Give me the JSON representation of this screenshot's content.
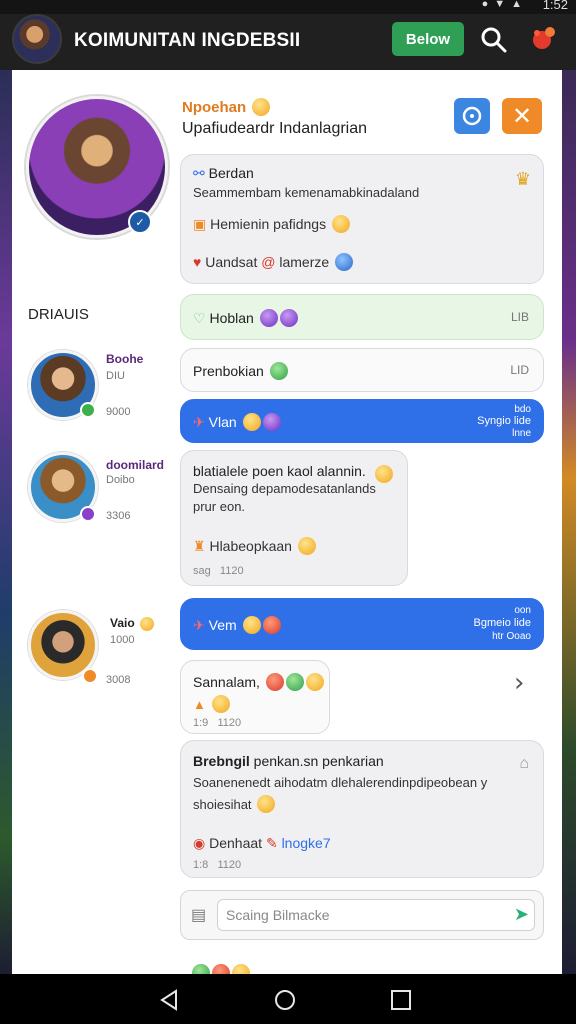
{
  "status": {
    "time": "1:52"
  },
  "header": {
    "title": "KOIMUNITAN INGDEBSII",
    "follow_label": "Below"
  },
  "profile": {
    "name": "Npoehan",
    "subtitle": "Upafiudeardr Indanlagrian"
  },
  "section_label": "DRIAUIS",
  "posts": {
    "p1_title": "Berdan",
    "p1_line": "Seammembam kemenamabkinadaland",
    "p1_item1": "Hemienin pafidngs",
    "p1_item2_a": "Uandsat",
    "p1_item2_b": "lamerze",
    "p2_title": "Hoblan",
    "p2_meta": "LIB",
    "p3_title": "Prenbokian",
    "p3_meta": "LID",
    "p4_title": "Vlan",
    "p4_meta_1": "bdo",
    "p4_meta_2": "Syngio lide",
    "p4_meta_3": "lnne",
    "p5_line1": "blatialele poen kaol alannin.",
    "p5_line2": "Densaing depamodesatanlands",
    "p5_line3": "prur eon.",
    "p5_item": "Hlabeopkaan",
    "p5_time_a": "sag",
    "p5_time_b": "1120",
    "p6_title": "Vem",
    "p6_meta_1": "oon",
    "p6_meta_2": "Bgmeio lide",
    "p6_meta_3": "htr Ooao",
    "p7_title": "Sannalam,",
    "p7_time_a": "1:9",
    "p7_time_b": "1120",
    "p8_title": "Brebngil",
    "p8_title_rest": "penkan.sn penkarian",
    "p8_line1": "Soanenenedt aihodatm dlehalerendinpdipeobean y",
    "p8_line2": "shoiesihat",
    "p8_item_a": "Denhaat",
    "p8_item_b": "lnogke7",
    "p8_time_a": "1:8",
    "p8_time_b": "1120"
  },
  "users": [
    {
      "name": "Boohe",
      "sub": "DIU",
      "meta": "9000"
    },
    {
      "name": "doomilard",
      "sub": "Doibo",
      "meta": "3306"
    },
    {
      "name": "Vaio",
      "sub": "1000",
      "meta": "3008"
    }
  ],
  "composer": {
    "placeholder": "Scaing Bilmacke"
  },
  "colors": {
    "header_bg": "#202020",
    "follow_green": "#2e9f55",
    "accent_blue": "#2f6fe8",
    "accent_orange": "#f08a28",
    "name_orange": "#e07b20"
  },
  "icons": [
    "search-icon",
    "notification-icon",
    "target-icon",
    "close-icon",
    "home-icon",
    "back-icon",
    "recents-icon",
    "attach-icon",
    "send-icon",
    "heart-icon",
    "chevron-right-icon"
  ]
}
